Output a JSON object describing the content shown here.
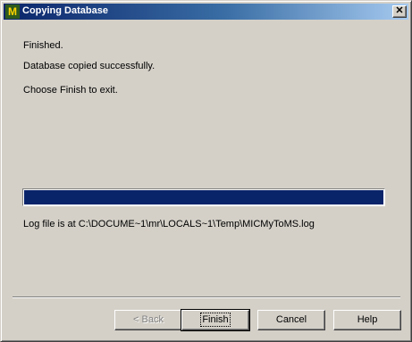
{
  "window": {
    "title": "Copying Database",
    "icon_glyph": "M",
    "close_glyph": "✕"
  },
  "message": {
    "status": "Finished.",
    "detail": "Database copied successfully.",
    "instruction": "Choose Finish to exit."
  },
  "progress": {
    "percent": 100,
    "fill_color": "#0a246a"
  },
  "log": {
    "text": "Log file is at C:\\DOCUME~1\\mr\\LOCALS~1\\Temp\\MICMyToMS.log"
  },
  "buttons": {
    "back": "< Back",
    "finish": "Finish",
    "cancel": "Cancel",
    "help": "Help"
  }
}
